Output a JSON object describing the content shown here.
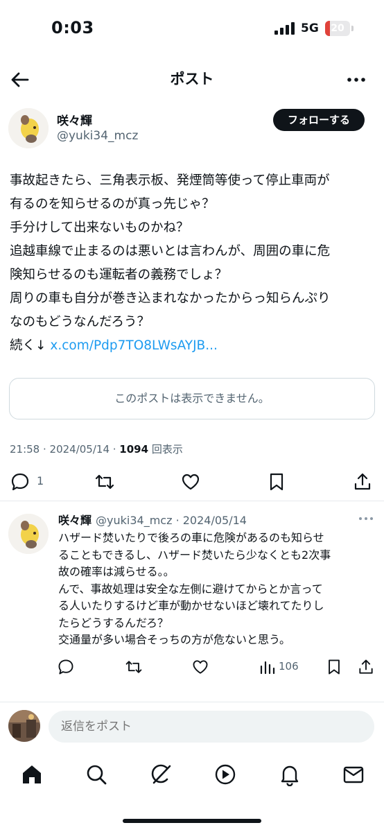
{
  "status_bar": {
    "time": "0:03",
    "network": "5G",
    "battery": "20",
    "battery_level": 0.2
  },
  "header": {
    "title": "ポスト"
  },
  "post": {
    "author_name": "咲々輝",
    "author_handle": "@yuki34_mcz",
    "follow_label": "フォローする",
    "text_lines": [
      "事故起きたら、三角表示板、発煙筒等使って停止車両が",
      "有るのを知らせるのが真っ先じゃ？",
      "手分けして出来ないものかね？",
      "追越車線で止まるのは悪いとは言わんが、周囲の車に危",
      "険知らせるのも運転者の義務でしょ？",
      "周りの車も自分が巻き込まれなかったからっ知らんぷり",
      "なのもどうなんだろう？"
    ],
    "continue_label": "続く↓",
    "link": "x.com/Pdp7TO8LWsAYJB...",
    "unavailable_notice": "このポストは表示できません。",
    "timestamp": "21:58 · 2024/05/14 · ",
    "views": "1094",
    "views_label": " 回表示",
    "reply_count": "1"
  },
  "reply": {
    "author_name": "咲々輝",
    "meta": "@yuki34_mcz · 2024/05/14",
    "text_lines": [
      "ハザード焚いたりで後ろの車に危険があるのも知らせ",
      "ることもできるし、ハザード焚いたら少なくとも2次事",
      "故の確率は減らせる。。",
      "んで、事故処理は安全な左側に避けてからとか言って",
      "る人いたりするけど車が動かせないほど壊れてたりし",
      "たらどうするんだろ？",
      "交通量が多い場合そっちの方が危ないと思う。"
    ],
    "views": "106"
  },
  "composer": {
    "placeholder": "返信をポスト"
  },
  "tabs": [
    "home-icon",
    "search-icon",
    "grok-icon",
    "video-icon",
    "notifications-icon",
    "messages-icon"
  ],
  "colors": {
    "accent": "#1d9bf0",
    "text": "#0f1419",
    "muted": "#536471",
    "battery": "#e0423a"
  }
}
